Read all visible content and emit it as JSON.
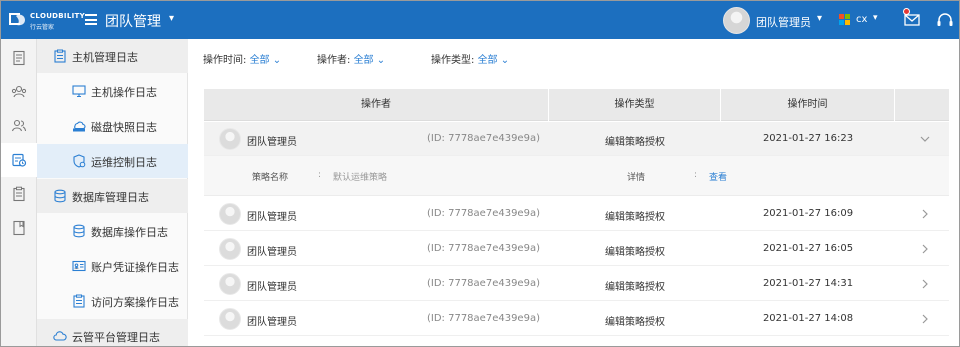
{
  "topbar": {
    "brand": "CLOUDBILITY",
    "brand_sub": "行云管家",
    "team_title": "团队管理",
    "user_name": "团队管理员",
    "tenant": "cx",
    "colors": {
      "bar": "#1c6fbf",
      "notify_dot": "#e53935"
    },
    "icons": [
      "menu-icon",
      "chevron-down-icon",
      "mail-icon",
      "headset-icon"
    ]
  },
  "rail": {
    "icons": [
      "document-icon",
      "team-icon",
      "users-icon",
      "audit-log-icon",
      "clipboard-icon",
      "book-icon"
    ],
    "active_index": 3
  },
  "subnav": {
    "items": [
      {
        "label": "主机管理日志",
        "level": 1,
        "icon": "clipboard-icon"
      },
      {
        "label": "主机操作日志",
        "level": 2,
        "icon": "monitor-icon"
      },
      {
        "label": "磁盘快照日志",
        "level": 2,
        "icon": "cloud-disk-icon"
      },
      {
        "label": "运维控制日志",
        "level": 2,
        "icon": "shield-icon",
        "selected": true
      },
      {
        "label": "数据库管理日志",
        "level": 1,
        "icon": "database-icon"
      },
      {
        "label": "数据库操作日志",
        "level": 2,
        "icon": "database-icon"
      },
      {
        "label": "账户凭证操作日志",
        "level": 2,
        "icon": "id-card-icon"
      },
      {
        "label": "访问方案操作日志",
        "level": 2,
        "icon": "clipboard-icon"
      },
      {
        "label": "云管平台管理日志",
        "level": 1,
        "icon": "cloud-icon"
      }
    ]
  },
  "filters": {
    "time_label": "操作时间:",
    "time_value": "全部",
    "operator_label": "操作者:",
    "operator_value": "全部",
    "type_label": "操作类型:",
    "type_value": "全部",
    "accent": "#2b7fd3"
  },
  "table": {
    "headers": [
      "操作者",
      "操作类型",
      "操作时间"
    ],
    "rows": [
      {
        "name": "团队管理员",
        "uid": "(ID: 7778ae7e439e9a)",
        "type": "编辑策略授权",
        "time": "2021-01-27 16:23",
        "expanded": true
      },
      {
        "name": "团队管理员",
        "uid": "(ID: 7778ae7e439e9a)",
        "type": "编辑策略授权",
        "time": "2021-01-27 16:09"
      },
      {
        "name": "团队管理员",
        "uid": "(ID: 7778ae7e439e9a)",
        "type": "编辑策略授权",
        "time": "2021-01-27 16:05"
      },
      {
        "name": "团队管理员",
        "uid": "(ID: 7778ae7e439e9a)",
        "type": "编辑策略授权",
        "time": "2021-01-27 14:31"
      },
      {
        "name": "团队管理员",
        "uid": "(ID: 7778ae7e439e9a)",
        "type": "编辑策略授权",
        "time": "2021-01-27 14:08"
      }
    ],
    "detail": {
      "policy_label": "策略名称",
      "policy_sep": ":",
      "policy_value": "默认运维策略",
      "detail_label": "详情",
      "detail_sep": ":",
      "detail_link": "查看"
    }
  }
}
